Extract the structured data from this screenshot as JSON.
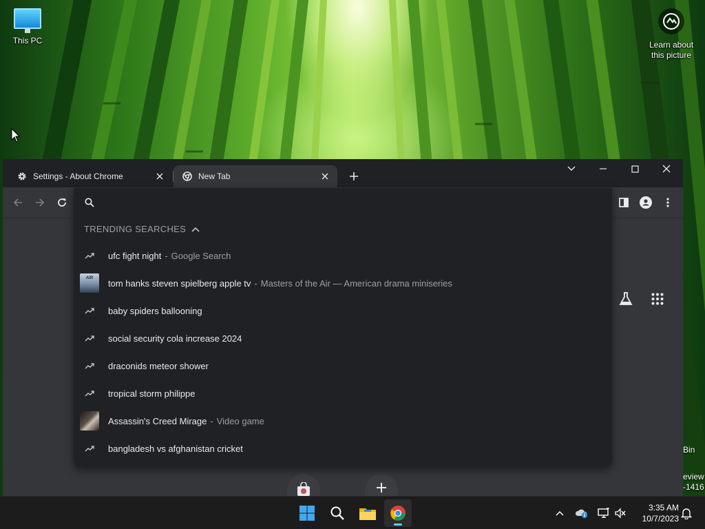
{
  "desktop": {
    "this_pc_label": "This PC",
    "learn_label_line1": "Learn about",
    "learn_label_line2": "this picture",
    "recycle_peek": "Bin",
    "preview_peek_1": "eview",
    "preview_peek_2": "-1416"
  },
  "tabs": [
    {
      "title": "Settings - About Chrome",
      "icon": "gear-icon"
    },
    {
      "title": "New Tab",
      "icon": "chrome-icon"
    }
  ],
  "omnibox": {
    "value": "",
    "placeholder": "",
    "section_header": "TRENDING SEARCHES"
  },
  "suggestions": [
    {
      "text": "ufc fight night",
      "subtitle": "Google Search",
      "icon": "trending-icon"
    },
    {
      "text": "tom hanks steven spielberg apple tv",
      "subtitle": "Masters of the Air — American drama miniseries",
      "icon": "thumbnail-masters-of-the-air"
    },
    {
      "text": "baby spiders ballooning",
      "subtitle": "",
      "icon": "trending-icon"
    },
    {
      "text": "social security cola increase 2024",
      "subtitle": "",
      "icon": "trending-icon"
    },
    {
      "text": "draconids meteor shower",
      "subtitle": "",
      "icon": "trending-icon"
    },
    {
      "text": "tropical storm philippe",
      "subtitle": "",
      "icon": "trending-icon"
    },
    {
      "text": "Assassin's Creed Mirage",
      "subtitle": "Video game",
      "icon": "thumbnail-assassins-creed-mirage"
    },
    {
      "text": "bangladesh vs afghanistan cricket",
      "subtitle": "",
      "icon": "trending-icon"
    }
  ],
  "thumb_air_text": "AIR",
  "taskbar": {
    "time": "3:35 AM",
    "date": "10/7/2023"
  },
  "colors": {
    "tabstrip": "#202124",
    "toolbar": "#35363a",
    "dropdown": "#202124",
    "text_primary": "#e8eaed",
    "text_secondary": "#9aa0a6",
    "taskbar": "#1c1c1c",
    "accent": "#60cdff"
  }
}
